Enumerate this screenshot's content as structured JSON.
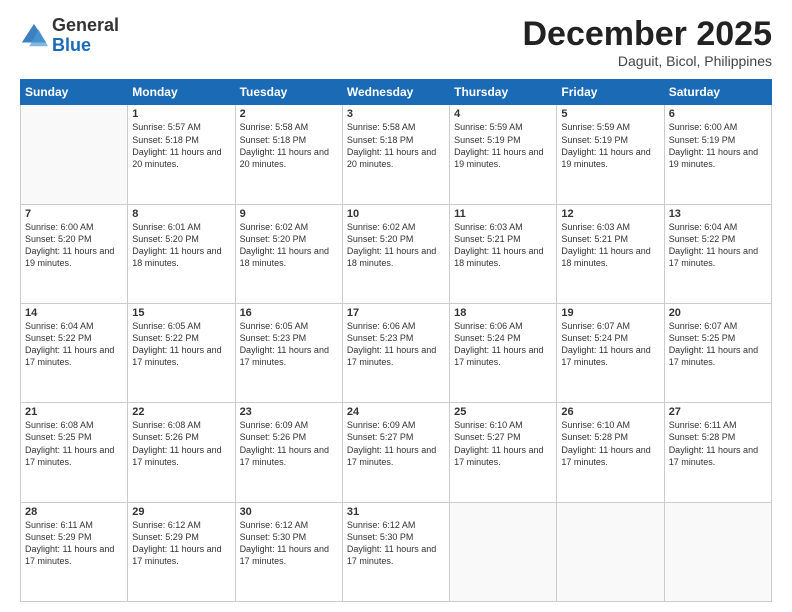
{
  "logo": {
    "general": "General",
    "blue": "Blue"
  },
  "title": "December 2025",
  "location": "Daguit, Bicol, Philippines",
  "weekdays": [
    "Sunday",
    "Monday",
    "Tuesday",
    "Wednesday",
    "Thursday",
    "Friday",
    "Saturday"
  ],
  "weeks": [
    [
      {
        "day": "",
        "sunrise": "",
        "sunset": "",
        "daylight": ""
      },
      {
        "day": "1",
        "sunrise": "Sunrise: 5:57 AM",
        "sunset": "Sunset: 5:18 PM",
        "daylight": "Daylight: 11 hours and 20 minutes."
      },
      {
        "day": "2",
        "sunrise": "Sunrise: 5:58 AM",
        "sunset": "Sunset: 5:18 PM",
        "daylight": "Daylight: 11 hours and 20 minutes."
      },
      {
        "day": "3",
        "sunrise": "Sunrise: 5:58 AM",
        "sunset": "Sunset: 5:18 PM",
        "daylight": "Daylight: 11 hours and 20 minutes."
      },
      {
        "day": "4",
        "sunrise": "Sunrise: 5:59 AM",
        "sunset": "Sunset: 5:19 PM",
        "daylight": "Daylight: 11 hours and 19 minutes."
      },
      {
        "day": "5",
        "sunrise": "Sunrise: 5:59 AM",
        "sunset": "Sunset: 5:19 PM",
        "daylight": "Daylight: 11 hours and 19 minutes."
      },
      {
        "day": "6",
        "sunrise": "Sunrise: 6:00 AM",
        "sunset": "Sunset: 5:19 PM",
        "daylight": "Daylight: 11 hours and 19 minutes."
      }
    ],
    [
      {
        "day": "7",
        "sunrise": "Sunrise: 6:00 AM",
        "sunset": "Sunset: 5:20 PM",
        "daylight": "Daylight: 11 hours and 19 minutes."
      },
      {
        "day": "8",
        "sunrise": "Sunrise: 6:01 AM",
        "sunset": "Sunset: 5:20 PM",
        "daylight": "Daylight: 11 hours and 18 minutes."
      },
      {
        "day": "9",
        "sunrise": "Sunrise: 6:02 AM",
        "sunset": "Sunset: 5:20 PM",
        "daylight": "Daylight: 11 hours and 18 minutes."
      },
      {
        "day": "10",
        "sunrise": "Sunrise: 6:02 AM",
        "sunset": "Sunset: 5:20 PM",
        "daylight": "Daylight: 11 hours and 18 minutes."
      },
      {
        "day": "11",
        "sunrise": "Sunrise: 6:03 AM",
        "sunset": "Sunset: 5:21 PM",
        "daylight": "Daylight: 11 hours and 18 minutes."
      },
      {
        "day": "12",
        "sunrise": "Sunrise: 6:03 AM",
        "sunset": "Sunset: 5:21 PM",
        "daylight": "Daylight: 11 hours and 18 minutes."
      },
      {
        "day": "13",
        "sunrise": "Sunrise: 6:04 AM",
        "sunset": "Sunset: 5:22 PM",
        "daylight": "Daylight: 11 hours and 17 minutes."
      }
    ],
    [
      {
        "day": "14",
        "sunrise": "Sunrise: 6:04 AM",
        "sunset": "Sunset: 5:22 PM",
        "daylight": "Daylight: 11 hours and 17 minutes."
      },
      {
        "day": "15",
        "sunrise": "Sunrise: 6:05 AM",
        "sunset": "Sunset: 5:22 PM",
        "daylight": "Daylight: 11 hours and 17 minutes."
      },
      {
        "day": "16",
        "sunrise": "Sunrise: 6:05 AM",
        "sunset": "Sunset: 5:23 PM",
        "daylight": "Daylight: 11 hours and 17 minutes."
      },
      {
        "day": "17",
        "sunrise": "Sunrise: 6:06 AM",
        "sunset": "Sunset: 5:23 PM",
        "daylight": "Daylight: 11 hours and 17 minutes."
      },
      {
        "day": "18",
        "sunrise": "Sunrise: 6:06 AM",
        "sunset": "Sunset: 5:24 PM",
        "daylight": "Daylight: 11 hours and 17 minutes."
      },
      {
        "day": "19",
        "sunrise": "Sunrise: 6:07 AM",
        "sunset": "Sunset: 5:24 PM",
        "daylight": "Daylight: 11 hours and 17 minutes."
      },
      {
        "day": "20",
        "sunrise": "Sunrise: 6:07 AM",
        "sunset": "Sunset: 5:25 PM",
        "daylight": "Daylight: 11 hours and 17 minutes."
      }
    ],
    [
      {
        "day": "21",
        "sunrise": "Sunrise: 6:08 AM",
        "sunset": "Sunset: 5:25 PM",
        "daylight": "Daylight: 11 hours and 17 minutes."
      },
      {
        "day": "22",
        "sunrise": "Sunrise: 6:08 AM",
        "sunset": "Sunset: 5:26 PM",
        "daylight": "Daylight: 11 hours and 17 minutes."
      },
      {
        "day": "23",
        "sunrise": "Sunrise: 6:09 AM",
        "sunset": "Sunset: 5:26 PM",
        "daylight": "Daylight: 11 hours and 17 minutes."
      },
      {
        "day": "24",
        "sunrise": "Sunrise: 6:09 AM",
        "sunset": "Sunset: 5:27 PM",
        "daylight": "Daylight: 11 hours and 17 minutes."
      },
      {
        "day": "25",
        "sunrise": "Sunrise: 6:10 AM",
        "sunset": "Sunset: 5:27 PM",
        "daylight": "Daylight: 11 hours and 17 minutes."
      },
      {
        "day": "26",
        "sunrise": "Sunrise: 6:10 AM",
        "sunset": "Sunset: 5:28 PM",
        "daylight": "Daylight: 11 hours and 17 minutes."
      },
      {
        "day": "27",
        "sunrise": "Sunrise: 6:11 AM",
        "sunset": "Sunset: 5:28 PM",
        "daylight": "Daylight: 11 hours and 17 minutes."
      }
    ],
    [
      {
        "day": "28",
        "sunrise": "Sunrise: 6:11 AM",
        "sunset": "Sunset: 5:29 PM",
        "daylight": "Daylight: 11 hours and 17 minutes."
      },
      {
        "day": "29",
        "sunrise": "Sunrise: 6:12 AM",
        "sunset": "Sunset: 5:29 PM",
        "daylight": "Daylight: 11 hours and 17 minutes."
      },
      {
        "day": "30",
        "sunrise": "Sunrise: 6:12 AM",
        "sunset": "Sunset: 5:30 PM",
        "daylight": "Daylight: 11 hours and 17 minutes."
      },
      {
        "day": "31",
        "sunrise": "Sunrise: 6:12 AM",
        "sunset": "Sunset: 5:30 PM",
        "daylight": "Daylight: 11 hours and 17 minutes."
      },
      {
        "day": "",
        "sunrise": "",
        "sunset": "",
        "daylight": ""
      },
      {
        "day": "",
        "sunrise": "",
        "sunset": "",
        "daylight": ""
      },
      {
        "day": "",
        "sunrise": "",
        "sunset": "",
        "daylight": ""
      }
    ]
  ]
}
